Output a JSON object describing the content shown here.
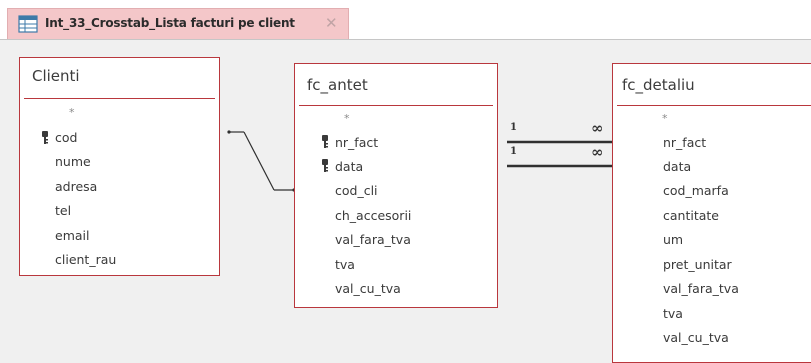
{
  "tab": {
    "title": "Int_33_Crosstab_Lista facturi pe client",
    "close_glyph": "✕",
    "icon": "query-icon"
  },
  "tables": {
    "clienti": {
      "title": "Clienti",
      "fields": [
        "*",
        "cod",
        "nume",
        "adresa",
        "tel",
        "email",
        "client_rau"
      ]
    },
    "fc_antet": {
      "title": "fc_antet",
      "fields": [
        "*",
        "nr_fact",
        "data",
        "cod_cli",
        "ch_accesorii",
        "val_fara_tva",
        "tva",
        "val_cu_tva"
      ]
    },
    "fc_detaliu": {
      "title": "fc_detaliu",
      "fields": [
        "*",
        "nr_fact",
        "data",
        "cod_marfa",
        "cantitate",
        "um",
        "pret_unitar",
        "val_fara_tva",
        "tva",
        "val_cu_tva"
      ]
    }
  },
  "relationships": {
    "one_label": "1",
    "many_label": "∞"
  },
  "colors": {
    "table_border": "#b9373d",
    "tab_background": "#f4c7c9",
    "canvas": "#f0f0f0"
  }
}
